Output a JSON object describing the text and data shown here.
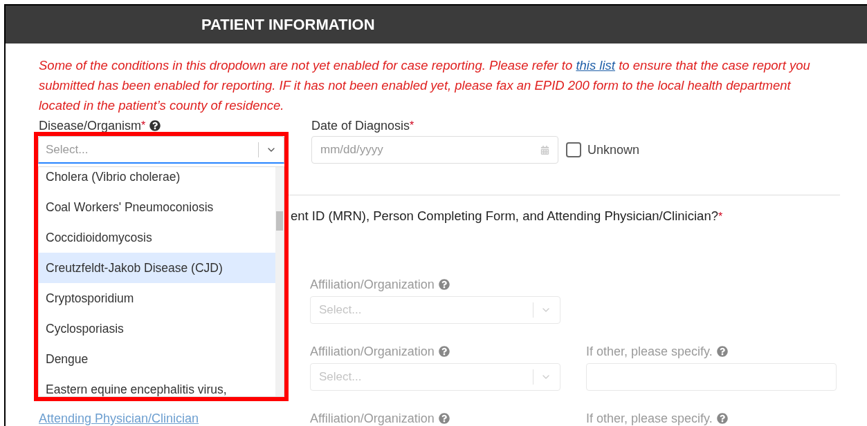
{
  "header": {
    "title": "PATIENT INFORMATION"
  },
  "notice": {
    "before": "Some of the conditions in this dropdown are not yet enabled for case reporting. Please refer to",
    "link": "this list",
    "after": "to ensure that the case report you submitted has been enabled for reporting. IF it has not been enabled yet, please fax an EPID 200 form to the local health department located in the patient’s county of residence."
  },
  "disease_field": {
    "label": "Disease/Organism",
    "required_mark": "*",
    "placeholder": "Select...",
    "expanded": true
  },
  "options": [
    {
      "label": "Cholera (Vibrio cholerae)",
      "selected": false
    },
    {
      "label": "Coal Workers' Pneumoconiosis",
      "selected": false
    },
    {
      "label": "Coccidioidomycosis",
      "selected": false
    },
    {
      "label": "Creutzfeldt-Jakob Disease (CJD)",
      "selected": true
    },
    {
      "label": "Cryptosporidium",
      "selected": false
    },
    {
      "label": "Cyclosporiasis",
      "selected": false
    },
    {
      "label": "Dengue",
      "selected": false
    },
    {
      "label": "Eastern equine encephalitis virus,",
      "selected": false
    }
  ],
  "date_field": {
    "label": "Date of Diagnosis",
    "required_mark": "*",
    "placeholder": "mm/dd/yyyy"
  },
  "unknown_checkbox": {
    "label": "Unknown",
    "checked": false
  },
  "question": {
    "text": "ent ID (MRN), Person Completing Form, and Attending Physician/Clinician?",
    "required_mark": "*"
  },
  "rows": [
    {
      "disabled": true,
      "affiliation": {
        "label": "Affiliation/Organization",
        "placeholder": "Select..."
      }
    },
    {
      "disabled": true,
      "affiliation": {
        "label": "Affiliation/Organization",
        "placeholder": "Select..."
      },
      "other": {
        "label": "If other, please specify.",
        "field": true
      }
    },
    {
      "disabled": true,
      "person_link": "Attending Physician/Clinician",
      "affiliation": {
        "label": "Affiliation/Organization"
      },
      "other": {
        "label": "If other, please specify.",
        "field": false
      }
    }
  ]
}
